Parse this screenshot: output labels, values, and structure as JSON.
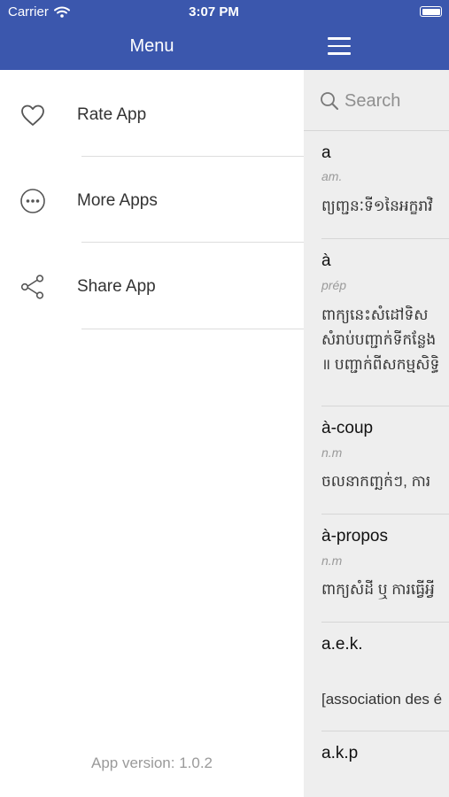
{
  "status_bar": {
    "carrier": "Carrier",
    "time": "3:07 PM"
  },
  "menu": {
    "title": "Menu",
    "items": [
      {
        "label": "Rate App",
        "icon": "heart-icon"
      },
      {
        "label": "More Apps",
        "icon": "more-horizontal-icon"
      },
      {
        "label": "Share App",
        "icon": "share-icon"
      }
    ],
    "version": "App version: 1.0.2"
  },
  "search": {
    "placeholder": "Search"
  },
  "entries": [
    {
      "word": "a",
      "pos": "am.",
      "def": [
        "ព្យញ្ជនៈទី១នៃអក្ខរាវិ"
      ]
    },
    {
      "word": "à",
      "pos": "prép",
      "def": [
        "ពាក្យនេះសំដៅទិស",
        "សំរាប់បញ្ជាក់ទីកន្លែង",
        "॥ បញ្ជាក់ពីសកម្មសិទ្ធិ"
      ]
    },
    {
      "word": "à-coup",
      "pos": "n.m",
      "def": [
        "ចលនាកញ្ឆក់ៗ, ការ"
      ]
    },
    {
      "word": "à-propos",
      "pos": "n.m",
      "def": [
        "ពាក្យសំដី ឬ ការធ្វើអ្វី"
      ]
    },
    {
      "word": "a.e.k.",
      "pos": "",
      "def": [
        "[association des é"
      ]
    },
    {
      "word": "a.k.p",
      "pos": "",
      "def": []
    }
  ],
  "colors": {
    "header": "#3b57ad",
    "panel_bg": "#eeeeee"
  }
}
